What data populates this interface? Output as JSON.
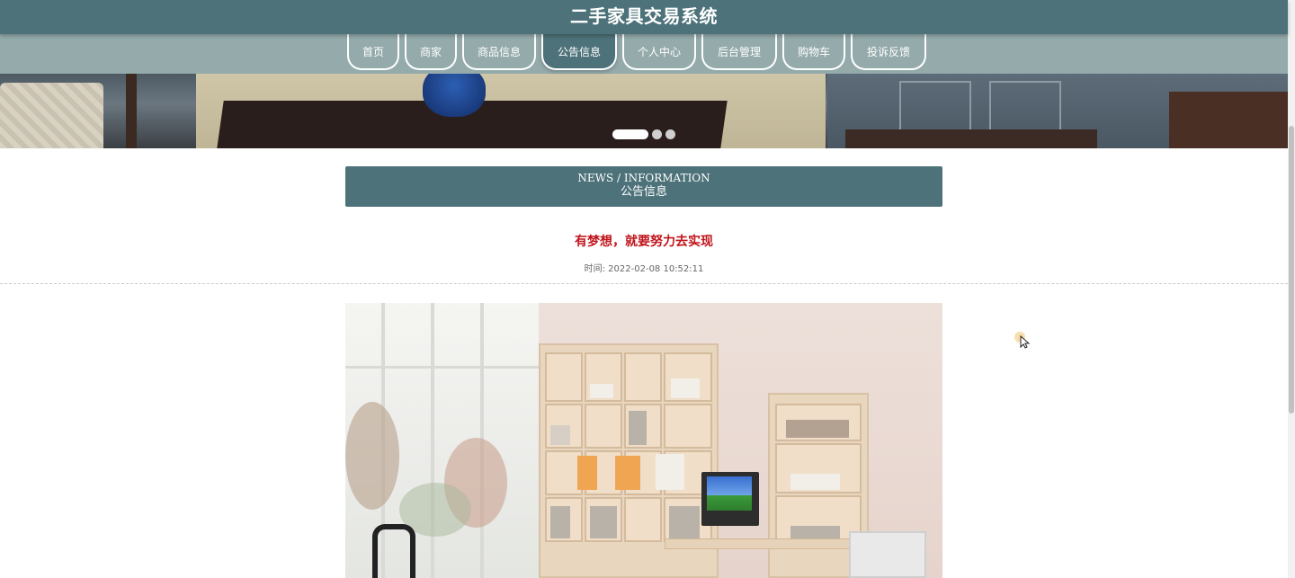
{
  "header": {
    "title": "二手家具交易系统"
  },
  "nav": {
    "items": [
      {
        "label": "首页",
        "active": false
      },
      {
        "label": "商家",
        "active": false
      },
      {
        "label": "商品信息",
        "active": false
      },
      {
        "label": "公告信息",
        "active": true
      },
      {
        "label": "个人中心",
        "active": false
      },
      {
        "label": "后台管理",
        "active": false
      },
      {
        "label": "购物车",
        "active": false
      },
      {
        "label": "投诉反馈",
        "active": false
      }
    ]
  },
  "banner": {
    "slides": 3,
    "active_slide": 1
  },
  "section": {
    "title_en": "NEWS / INFORMATION",
    "title_zh": "公告信息"
  },
  "article": {
    "title": "有梦想，就要努力去实现",
    "time_label": "时间:",
    "time_value": "2022-02-08 10:52:11"
  },
  "colors": {
    "header_bg": "#4d7279",
    "nav_bg": "#94aaab",
    "title_red": "#c0151b"
  }
}
